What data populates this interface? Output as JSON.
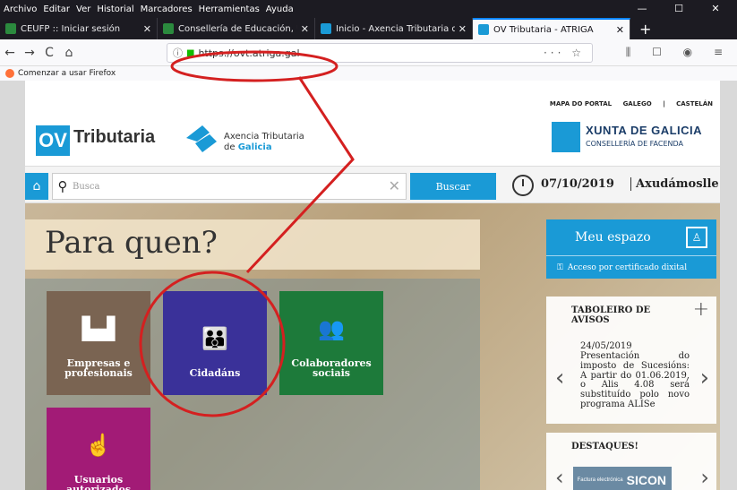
{
  "menu": [
    "Archivo",
    "Editar",
    "Ver",
    "Historial",
    "Marcadores",
    "Herramientas",
    "Ayuda"
  ],
  "window_controls": [
    "—",
    "☐",
    "✕"
  ],
  "tabs": [
    {
      "label": "CEUFP :: Iniciar sesión",
      "color": "#2b8a3e"
    },
    {
      "label": "Consellería de Educación, Unive",
      "color": "#2b8a3e"
    },
    {
      "label": "Inicio - Axencia Tributaria de Ga",
      "color": "#1a9ad6"
    },
    {
      "label": "OV Tributaria - ATRIGA",
      "color": "#1a9ad6"
    }
  ],
  "new_tab": "+",
  "nav": {
    "back": "←",
    "forward": "→",
    "reload": "C",
    "home": "⌂",
    "url": "https://ovt.atriga.gal",
    "url_actions": "··· ☆",
    "right_icons": "⫼ ☐ ◉ ≡"
  },
  "bookmark": "Comenzar a usar Firefox",
  "site": {
    "topline": [
      "MAPA DO PORTAL",
      "GALEGO",
      "|",
      "CASTELÁN"
    ],
    "logo_ov": "OV",
    "logo_trib": "Tributaria",
    "axencia_1": "Axencia Tributaria",
    "axencia_2a": "de ",
    "axencia_2b": "Galicia",
    "xunta_1": "XUNTA DE GALICIA",
    "xunta_2": "CONSELLERÍA DE FACENDA",
    "search_placeholder": "Busca",
    "search_button": "Buscar",
    "date": "07/10/2019",
    "help": "Axudámoslle!",
    "para_quen": "Para quen?",
    "tiles": [
      {
        "label": "Empresas e profesionais",
        "icon": "factory-icon"
      },
      {
        "label": "Cidadáns",
        "icon": "people-icon"
      },
      {
        "label": "Colaboradores sociais",
        "icon": "group-icon"
      },
      {
        "label": "Usuarios autorizados",
        "icon": "id-card-icon"
      }
    ],
    "meu_espazo": "Meu espazo",
    "certificado": "Acceso por certificado dixital",
    "avisos_title_1": "TABOLEIRO DE",
    "avisos_title_2": "AVISOS",
    "aviso_date": "24/05/2019",
    "aviso_body": "Presentación do imposto de Sucesións: A partir do 01.06.2019, o Alis 4.08 será substituído polo novo programa ALISe",
    "destaques": "DESTAQUES!",
    "destaque_img_text": "SICON",
    "destaque_img_small": "Factura electrónica"
  }
}
